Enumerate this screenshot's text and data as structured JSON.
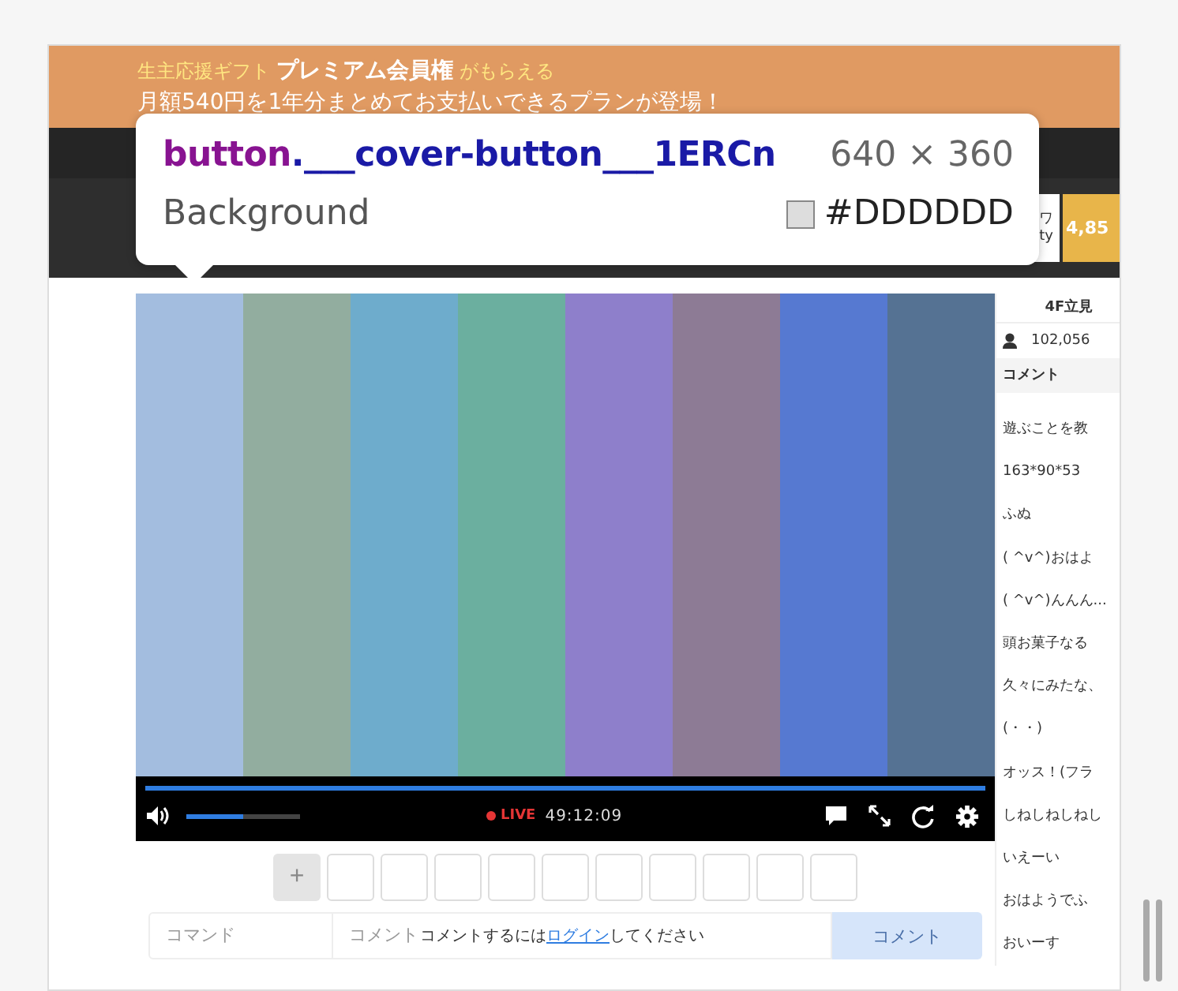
{
  "banner": {
    "gift_label": "生主応援ギフト",
    "premium": "プレミアム会員権",
    "suffix": "がもらえる",
    "subtitle": "月額540円を1年分まとめてお支払いできるプランが登場！"
  },
  "header": {
    "fragment_top": "ワ",
    "fragment_bottom": "ty",
    "badge": "4,85"
  },
  "tooltip": {
    "tag": "button",
    "class_name": ".___cover-button___1ERCn",
    "size": "640 × 360",
    "property": "Background",
    "value": "#DDDDDD"
  },
  "player": {
    "seek": {
      "level": 1.0
    },
    "volume": {
      "level": 0.5
    },
    "live_label": "LIVE",
    "time": "49:12:09"
  },
  "stamps": {
    "add": "+",
    "slots": [
      {
        "filled": false
      },
      {
        "filled": false
      },
      {
        "filled": false
      },
      {
        "filled": false
      },
      {
        "filled": false
      },
      {
        "filled": false
      },
      {
        "filled": false
      },
      {
        "filled": false
      },
      {
        "filled": false
      },
      {
        "filled": false
      }
    ]
  },
  "comment_form": {
    "command_placeholder": "コマンド",
    "comment_placeholder": "コメント",
    "submit": "コメント",
    "notice_before": "コメントするには",
    "notice_link": "ログイン",
    "notice_after": "してください"
  },
  "side_panel": {
    "title": "4F立見",
    "viewers": "102,056",
    "heading": "コメント",
    "comments": [
      "遊ぶことを教",
      "163*90*53",
      "ふぬ",
      "( ^v^)おはよ",
      "( ^v^)んんん...",
      "頭お菓子なる",
      "久々にみたな、",
      "(・・)",
      "オッス！(フラ",
      "しねしねしねし",
      "いえーい",
      "おはようでふ",
      "おいーす"
    ]
  }
}
